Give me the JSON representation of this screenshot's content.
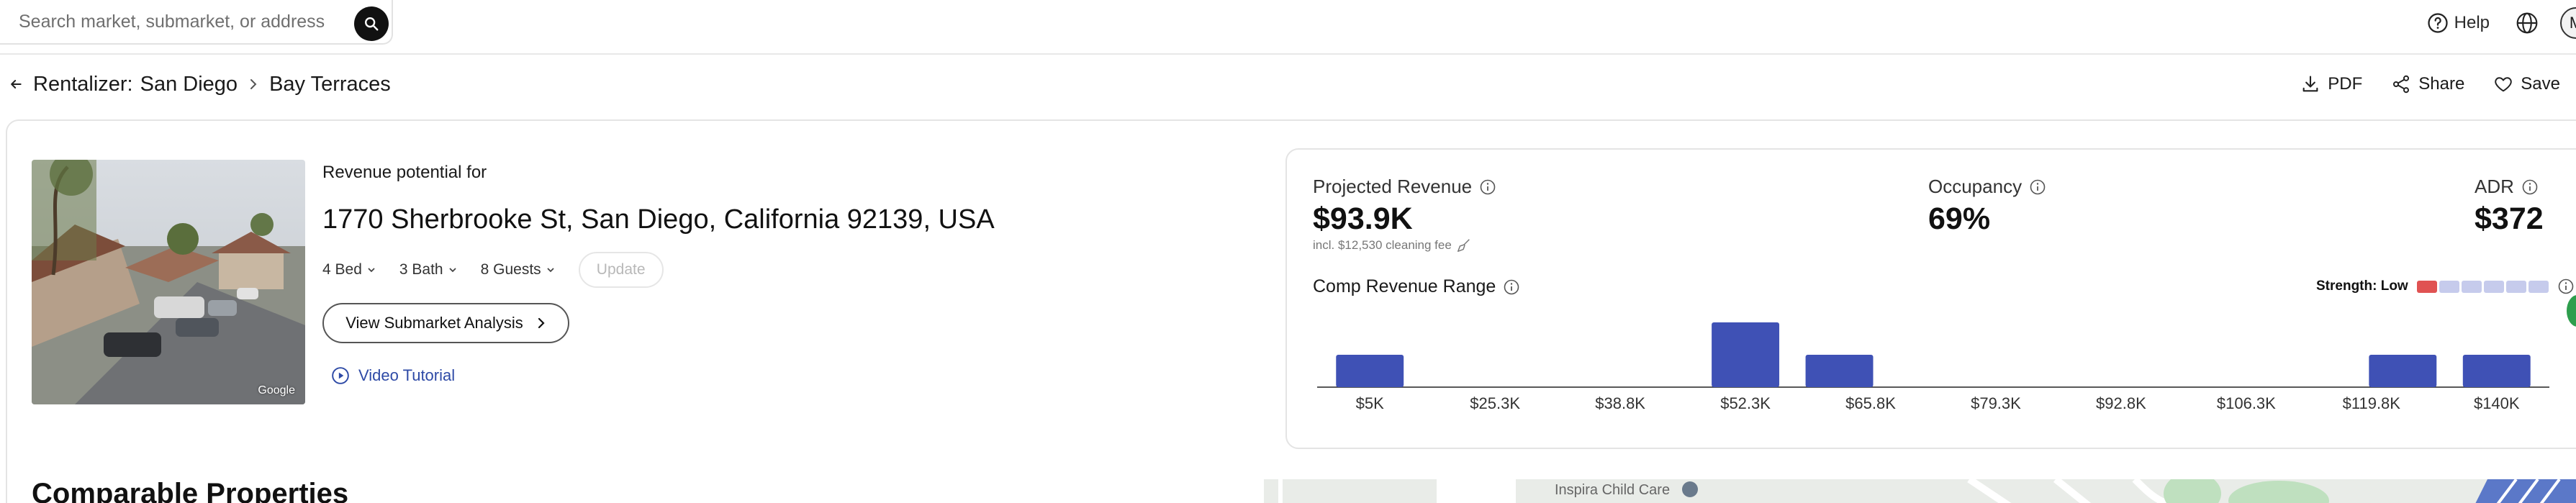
{
  "search": {
    "placeholder": "Search market, submarket, or address"
  },
  "header": {
    "help_label": "Help",
    "avatar_initial": "M"
  },
  "breadcrumb": {
    "prefix": "Rentalizer:",
    "market": "San Diego",
    "submarket": "Bay Terraces"
  },
  "actions": {
    "pdf": "PDF",
    "share": "Share",
    "save": "Save"
  },
  "property": {
    "revenue_label": "Revenue potential for",
    "address": "1770 Sherbrooke St, San Diego, California 92139, USA",
    "bed": "4 Bed",
    "bath": "3 Bath",
    "guests": "8 Guests",
    "update_label": "Update",
    "submarket_button": "View Submarket Analysis",
    "tutorial_label": "Video Tutorial",
    "photo_credit": "Google"
  },
  "metrics": {
    "projected_label": "Projected Revenue",
    "projected_value": "$93.9K",
    "cleaning_note": "incl. $12,530 cleaning fee",
    "occupancy_label": "Occupancy",
    "occupancy_value": "69%",
    "adr_label": "ADR",
    "adr_value": "$372",
    "range_label": "Comp Revenue Range",
    "strength_label": "Strength: Low",
    "strength_level": 1,
    "strength_total": 6,
    "colors": {
      "bar": "#3f51b5",
      "strength_active": "#e05252",
      "strength_inactive": "#c6cbec"
    }
  },
  "chart_data": {
    "type": "bar",
    "categories": [
      "$5K",
      "$25.3K",
      "$38.8K",
      "$52.3K",
      "$65.8K",
      "$79.3K",
      "$92.8K",
      "$106.3K",
      "$119.8K",
      "$140K"
    ],
    "series": [
      {
        "values": [
          1,
          0,
          0,
          0,
          2,
          1,
          0,
          0,
          0,
          0,
          0,
          1,
          1
        ]
      }
    ],
    "xlabel": "",
    "ylabel": ""
  },
  "below": {
    "comparable_title": "Comparable Properties",
    "map_label": "Inspira Child Care"
  }
}
